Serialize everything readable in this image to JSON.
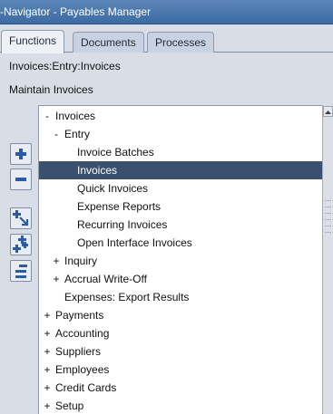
{
  "window": {
    "title": "-Navigator - Payables Manager"
  },
  "tabs": [
    {
      "label": "Functions",
      "active": true
    },
    {
      "label": "Documents",
      "active": false
    },
    {
      "label": "Processes",
      "active": false
    }
  ],
  "breadcrumb": "Invoices:Entry:Invoices",
  "description": "Maintain Invoices",
  "tree": [
    {
      "sign": "-",
      "label": "Invoices",
      "level": 0
    },
    {
      "sign": "-",
      "label": "Entry",
      "level": 1
    },
    {
      "sign": "",
      "label": "Invoice Batches",
      "level": 2
    },
    {
      "sign": "",
      "label": "Invoices",
      "level": 2,
      "selected": true
    },
    {
      "sign": "",
      "label": "Quick Invoices",
      "level": 2
    },
    {
      "sign": "",
      "label": "Expense Reports",
      "level": 2
    },
    {
      "sign": "",
      "label": "Recurring Invoices",
      "level": 2
    },
    {
      "sign": "",
      "label": "Open Interface Invoices",
      "level": 2
    },
    {
      "sign": "+",
      "label": "Inquiry",
      "level": 1
    },
    {
      "sign": "+",
      "label": "Accrual Write-Off",
      "level": 1
    },
    {
      "sign": "",
      "label": "Expenses: Export Results",
      "level": 1
    },
    {
      "sign": "+",
      "label": "Payments",
      "level": 0
    },
    {
      "sign": "+",
      "label": "Accounting",
      "level": 0
    },
    {
      "sign": "+",
      "label": "Suppliers",
      "level": 0
    },
    {
      "sign": "+",
      "label": "Employees",
      "level": 0
    },
    {
      "sign": "+",
      "label": "Credit Cards",
      "level": 0
    },
    {
      "sign": "+",
      "label": "Setup",
      "level": 0
    }
  ],
  "side_buttons": [
    {
      "name": "expand-button",
      "icon": "plus-icon"
    },
    {
      "name": "collapse-button",
      "icon": "minus-icon"
    },
    {
      "name": "expand-branch-button",
      "icon": "expand-branch-icon"
    },
    {
      "name": "expand-all-button",
      "icon": "expand-all-icon"
    },
    {
      "name": "collapse-all-button",
      "icon": "collapse-all-icon"
    }
  ],
  "colors": {
    "selection": "#3b506f",
    "title_bar": "#3c6aa3"
  }
}
